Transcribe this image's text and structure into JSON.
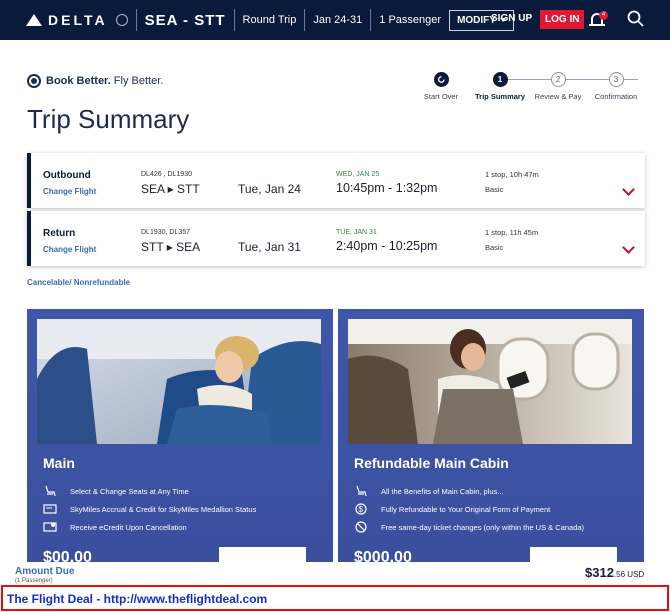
{
  "header": {
    "brand": "DELTA",
    "route": "SEA - STT",
    "trip_type": "Round Trip",
    "dates": "Jan 24-31",
    "passengers": "1 Passenger",
    "modify_label": "MODIFY",
    "signup_label": "SIGN UP",
    "login_label": "LOG IN",
    "notification_count": "4"
  },
  "brand_line": {
    "bold": "Book Better.",
    "rest": "Fly Better."
  },
  "stepper": [
    {
      "num": "",
      "label": "Start Over",
      "active": false
    },
    {
      "num": "1",
      "label": "Trip Summary",
      "active": true
    },
    {
      "num": "2",
      "label": "Review & Pay",
      "active": false
    },
    {
      "num": "3",
      "label": "Confirmation",
      "active": false
    }
  ],
  "page_title": "Trip Summary",
  "flights": [
    {
      "direction": "Outbound",
      "change_label": "Change Flight",
      "flight_numbers": "DL426 , DL1930",
      "route": "SEA ▸ STT",
      "date": "Tue, Jan 24",
      "arrival_note": "WED, JAN 25",
      "times": "10:45pm - 1:32pm",
      "stops": "1 stop, 10h 47m",
      "cabin": "Basic"
    },
    {
      "direction": "Return",
      "change_label": "Change Flight",
      "flight_numbers": "DL1930, DL357",
      "route": "STT ▸ SEA",
      "date": "Tue, Jan 31",
      "arrival_note": "TUE, JAN 31",
      "times": "2:40pm - 10:25pm",
      "stops": "1 stop, 11h 45m",
      "cabin": "Basic"
    }
  ],
  "cancel_note": "Cancelable/ Nonrefundable",
  "fares": [
    {
      "name": "Main",
      "features": [
        "Select & Change Seats at Any Time",
        "SkyMiles Accrual & Credit for SkyMiles Medallion Status",
        "Receive eCredit Upon Cancellation"
      ],
      "price": "$00.00"
    },
    {
      "name": "Refundable Main Cabin",
      "features": [
        "All the Benefits of Main Cabin, plus...",
        "Fully Refundable to Your Original Form of Payment",
        "Free same-day ticket changes (only within the US & Canada)"
      ],
      "price": "$000.00"
    }
  ],
  "amount": {
    "label": "Amount Due",
    "sub": "(1 Passenger)",
    "whole": "$312",
    "cents": ".56 USD"
  },
  "watermark": "The Flight Deal - http://www.theflightdeal.com",
  "colors": {
    "navy": "#0a1a3a",
    "red": "#e01933",
    "panel_blue": "#3f57a8",
    "link_blue": "#3a6bb5"
  }
}
